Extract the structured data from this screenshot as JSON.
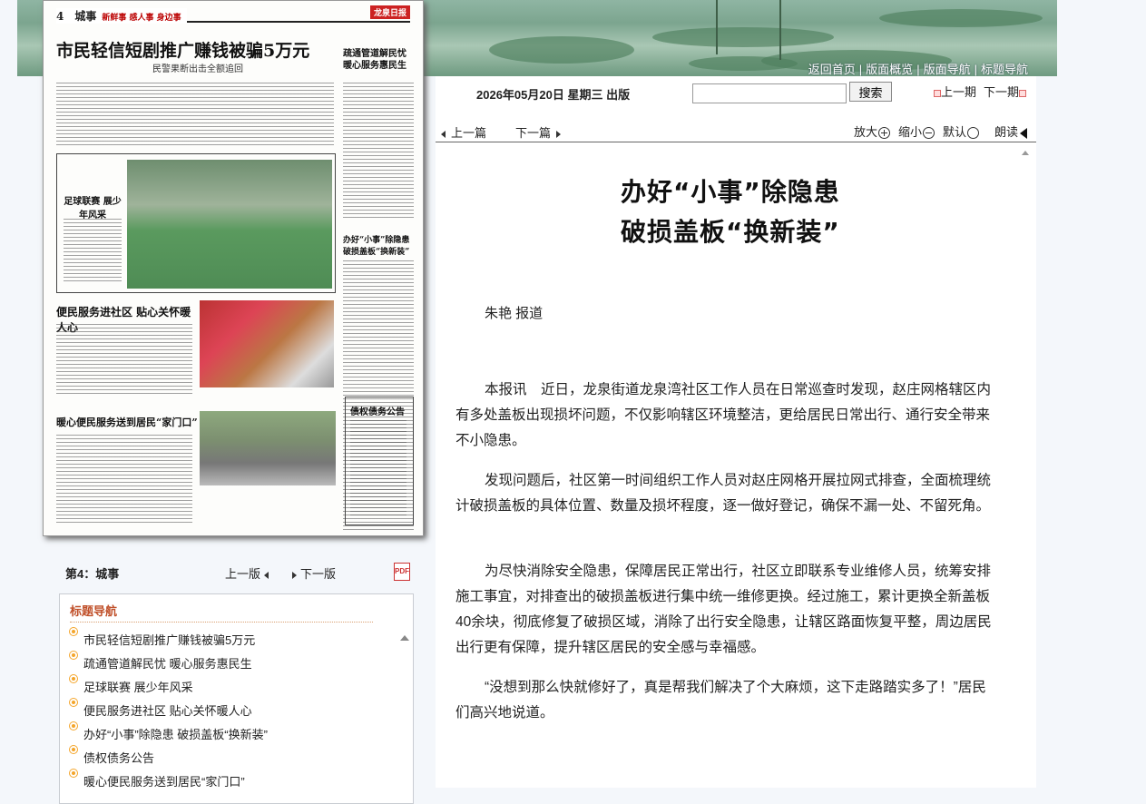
{
  "banner": {
    "links": [
      "返回首页",
      "版面概览",
      "版面导航",
      "标题导航"
    ]
  },
  "paper": {
    "page_no": "4",
    "section": "城事",
    "slogan": "新鲜事 感人事 身边事",
    "logo": "龙泉日报",
    "headline": "市民轻信短剧推广赚钱被骗5万元",
    "subhead": "民警果断出击全额追回",
    "side_title": "疏通管道解民忧 暖心服务惠民生",
    "story2": "足球联赛 展少年风采",
    "story3": "便民服务进社区 贴心关怀暖人心",
    "story4": "暖心便民服务送到居民“家门口”",
    "story5": "办好“小事”除隐患 破损盖板“换新装”",
    "notice": "债权债务公告"
  },
  "page_nav": {
    "label": "第4：城事",
    "prev": "上一版",
    "next": "下一版",
    "pdf": "PDF"
  },
  "title_nav": {
    "header": "标题导航",
    "items": [
      "市民轻信短剧推广赚钱被骗5万元",
      "疏通管道解民忧 暖心服务惠民生",
      "足球联赛 展少年风采",
      "便民服务进社区 贴心关怀暖人心",
      "办好“小事”除隐患 破损盖板“换新装”",
      "债权债务公告",
      "暖心便民服务送到居民“家门口”"
    ]
  },
  "topbar": {
    "date": "2026年05月20日 星期三 出版",
    "search_value": "",
    "search_button": "搜索",
    "issue_prev": "上一期",
    "issue_next": "下一期"
  },
  "toolbar": {
    "prev_article": "上一篇",
    "next_article": "下一篇",
    "zoom_in": "放大",
    "zoom_out": "缩小",
    "zoom_default": "默认",
    "read_aloud": "朗读"
  },
  "article": {
    "title_line1": "办好“小事”除隐患",
    "title_line2": "破损盖板“换新装”",
    "byline": "朱艳 报道",
    "paragraphs": [
      "本报讯　近日，龙泉街道龙泉湾社区工作人员在日常巡查时发现，赵庄网格辖区内有多处盖板出现损坏问题，不仅影响辖区环境整洁，更给居民日常出行、通行安全带来不小隐患。",
      "发现问题后，社区第一时间组织工作人员对赵庄网格开展拉网式排查，全面梳理统计破损盖板的具体位置、数量及损坏程度，逐一做好登记，确保不漏一处、不留死角。",
      "为尽快消除安全隐患，保障居民正常出行，社区立即联系专业维修人员，统筹安排施工事宜，对排查出的破损盖板进行集中统一维修更换。经过施工，累计更换全新盖板40余块，彻底修复了破损区域，消除了出行安全隐患，让辖区路面恢复平整，周边居民出行更有保障，提升辖区居民的安全感与幸福感。",
      "“没想到那么快就修好了，真是帮我们解决了个大麻烦，这下走路踏实多了！”居民们高兴地说道。"
    ]
  }
}
